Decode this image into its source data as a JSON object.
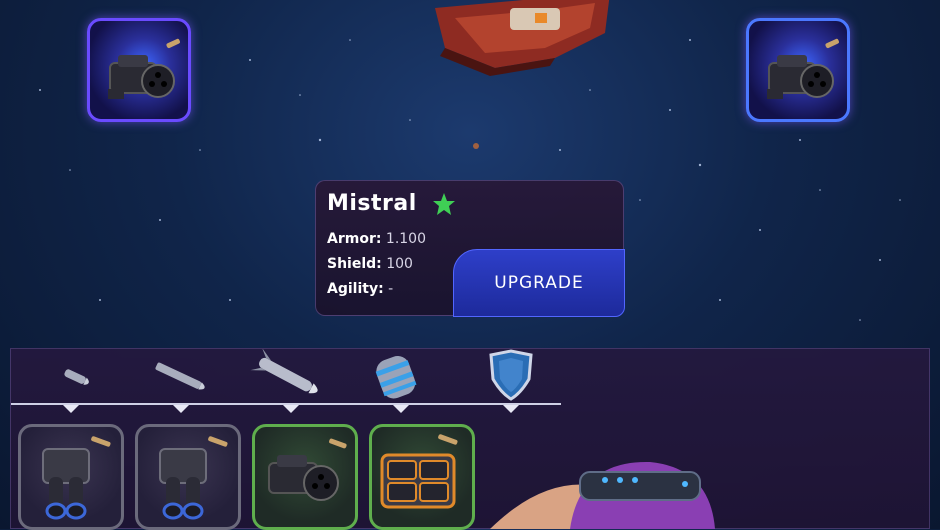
{
  "ship_card": {
    "name": "Mistral",
    "stats": [
      {
        "label": "Armor:",
        "value": "1.100"
      },
      {
        "label": "Shield:",
        "value": "100"
      },
      {
        "label": "Agility:",
        "value": "-"
      }
    ],
    "upgrade_label": "UPGRADE",
    "star_color": "#3fcf55"
  },
  "top_slots": [
    {
      "icon": "gatling-gun-icon"
    },
    {
      "icon": "gatling-gun-icon"
    }
  ],
  "tabs": [
    {
      "icon": "bullet-small-icon"
    },
    {
      "icon": "bullet-large-icon"
    },
    {
      "icon": "missile-icon"
    },
    {
      "icon": "energy-cell-icon"
    },
    {
      "icon": "shield-icon"
    }
  ],
  "items": [
    {
      "icon": "twin-cannon-icon",
      "rarity": "common"
    },
    {
      "icon": "twin-cannon-icon",
      "rarity": "common"
    },
    {
      "icon": "gatling-gun-icon",
      "rarity": "uncommon"
    },
    {
      "icon": "missile-pod-icon",
      "rarity": "uncommon"
    }
  ],
  "colors": {
    "slot_border": "#6a4bff",
    "upgrade_button": "#2e3fc9",
    "uncommon_border": "#5fae4d"
  }
}
